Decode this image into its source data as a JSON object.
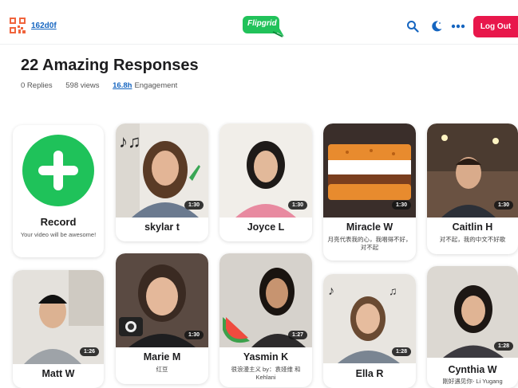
{
  "header": {
    "code": "162d0f",
    "logo_text": "Flipgrid",
    "logout_label": "Log Out"
  },
  "topic": {
    "title": "22 Amazing Responses",
    "replies": "0 Replies",
    "views": "598 views",
    "engagement_value": "16.8h",
    "engagement_label": "Engagement"
  },
  "record_card": {
    "title": "Record",
    "subtitle": "Your video will be awesome!"
  },
  "responses": [
    {
      "name": "skylar t",
      "duration": "1:30",
      "subtitle": ""
    },
    {
      "name": "Joyce L",
      "duration": "1:30",
      "subtitle": ""
    },
    {
      "name": "Miracle W",
      "duration": "1:30",
      "subtitle": "月亮代表我的心，我唱得不好，对不起"
    },
    {
      "name": "Caitlin H",
      "duration": "1:30",
      "subtitle": "对不起，我的中文不好歌"
    },
    {
      "name": "Matt W",
      "duration": "1:26",
      "subtitle": ""
    },
    {
      "name": "Marie M",
      "duration": "1:30",
      "subtitle": "红豆"
    },
    {
      "name": "Yasmin K",
      "duration": "1:27",
      "subtitle": "很浪漫主义 by：袁娅维 和 Kehlani"
    },
    {
      "name": "Ella R",
      "duration": "1:28",
      "subtitle": ""
    },
    {
      "name": "Cynthia W",
      "duration": "1:28",
      "subtitle": "刚好遇见你- Li Yugang"
    }
  ],
  "colors": {
    "accent_green": "#1fc25a",
    "logout_red": "#e8174b",
    "link_blue": "#1565c0"
  }
}
